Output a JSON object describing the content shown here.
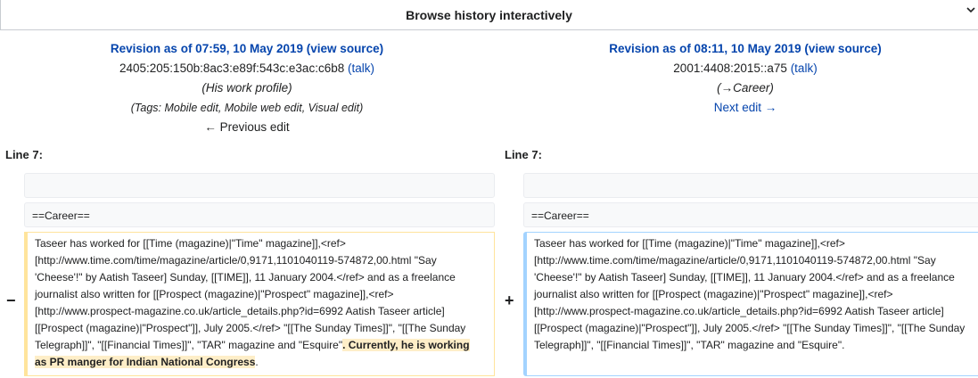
{
  "header": {
    "title": "Browse history interactively",
    "chevron_icon": "chevron-down-icon"
  },
  "left_revision": {
    "title_prefix": "Revision as of 07:59, 10 May 2019",
    "view_source": "(view source)",
    "user": "2405:205:150b:8ac3:e89f:543c:e3ac:c6b8",
    "talk": "(talk)",
    "comment": "(His work profile)",
    "tags": "(Tags: Mobile edit, Mobile web edit, Visual edit)",
    "nav": "← Previous edit"
  },
  "right_revision": {
    "title_prefix": "Revision as of 08:11, 10 May 2019",
    "view_source": "(view source)",
    "user": "2001:4408:2015::a75",
    "talk": "(talk)",
    "comment": "(→Career)",
    "nav": "Next edit →"
  },
  "diff": {
    "left_line_label": "Line 7:",
    "right_line_label": "Line 7:",
    "context_line_2": "==Career==",
    "minus": "−",
    "plus": "+",
    "left_text_lines": [
      "Taseer has worked for [[Time (magazine)|\"Time\" magazine]],<ref>",
      "[http://www.time.com/time/magazine/article/0,9171,1101040119-574872,00.html \"Say",
      "'Cheese'!\" by Aatish Taseer] Sunday, [[TIME]], 11 January 2004.</ref> and as a freelance",
      "journalist also written for [[Prospect (magazine)|\"Prospect\" magazine]],<ref>",
      "[http://www.prospect-magazine.co.uk/article_details.php?id=6992 Aatish Taseer article]",
      "[[Prospect (magazine)|\"Prospect\"]], July 2005.</ref> \"[[The Sunday Times]]\", \"[[The Sunday",
      "Telegraph]]\", \"[[Financial Times]]\", \"TAR\" magazine and \"Esquire\""
    ],
    "left_added_1": ". Currently, he is working",
    "left_added_2": "as PR manger for Indian National Congress",
    "left_end": ".",
    "right_text_lines": [
      "Taseer has worked for [[Time (magazine)|\"Time\" magazine]],<ref>",
      "[http://www.time.com/time/magazine/article/0,9171,1101040119-574872,00.html \"Say",
      "'Cheese'!\" by Aatish Taseer] Sunday, [[TIME]], 11 January 2004.</ref> and as a freelance",
      "journalist also written for [[Prospect (magazine)|\"Prospect\" magazine]],<ref>",
      "[http://www.prospect-magazine.co.uk/article_details.php?id=6992 Aatish Taseer article]",
      "[[Prospect (magazine)|\"Prospect\"]], July 2005.</ref> \"[[The Sunday Times]]\", \"[[The Sunday",
      "Telegraph]]\", \"[[Financial Times]]\", \"TAR\" magazine and \"Esquire\"."
    ]
  }
}
